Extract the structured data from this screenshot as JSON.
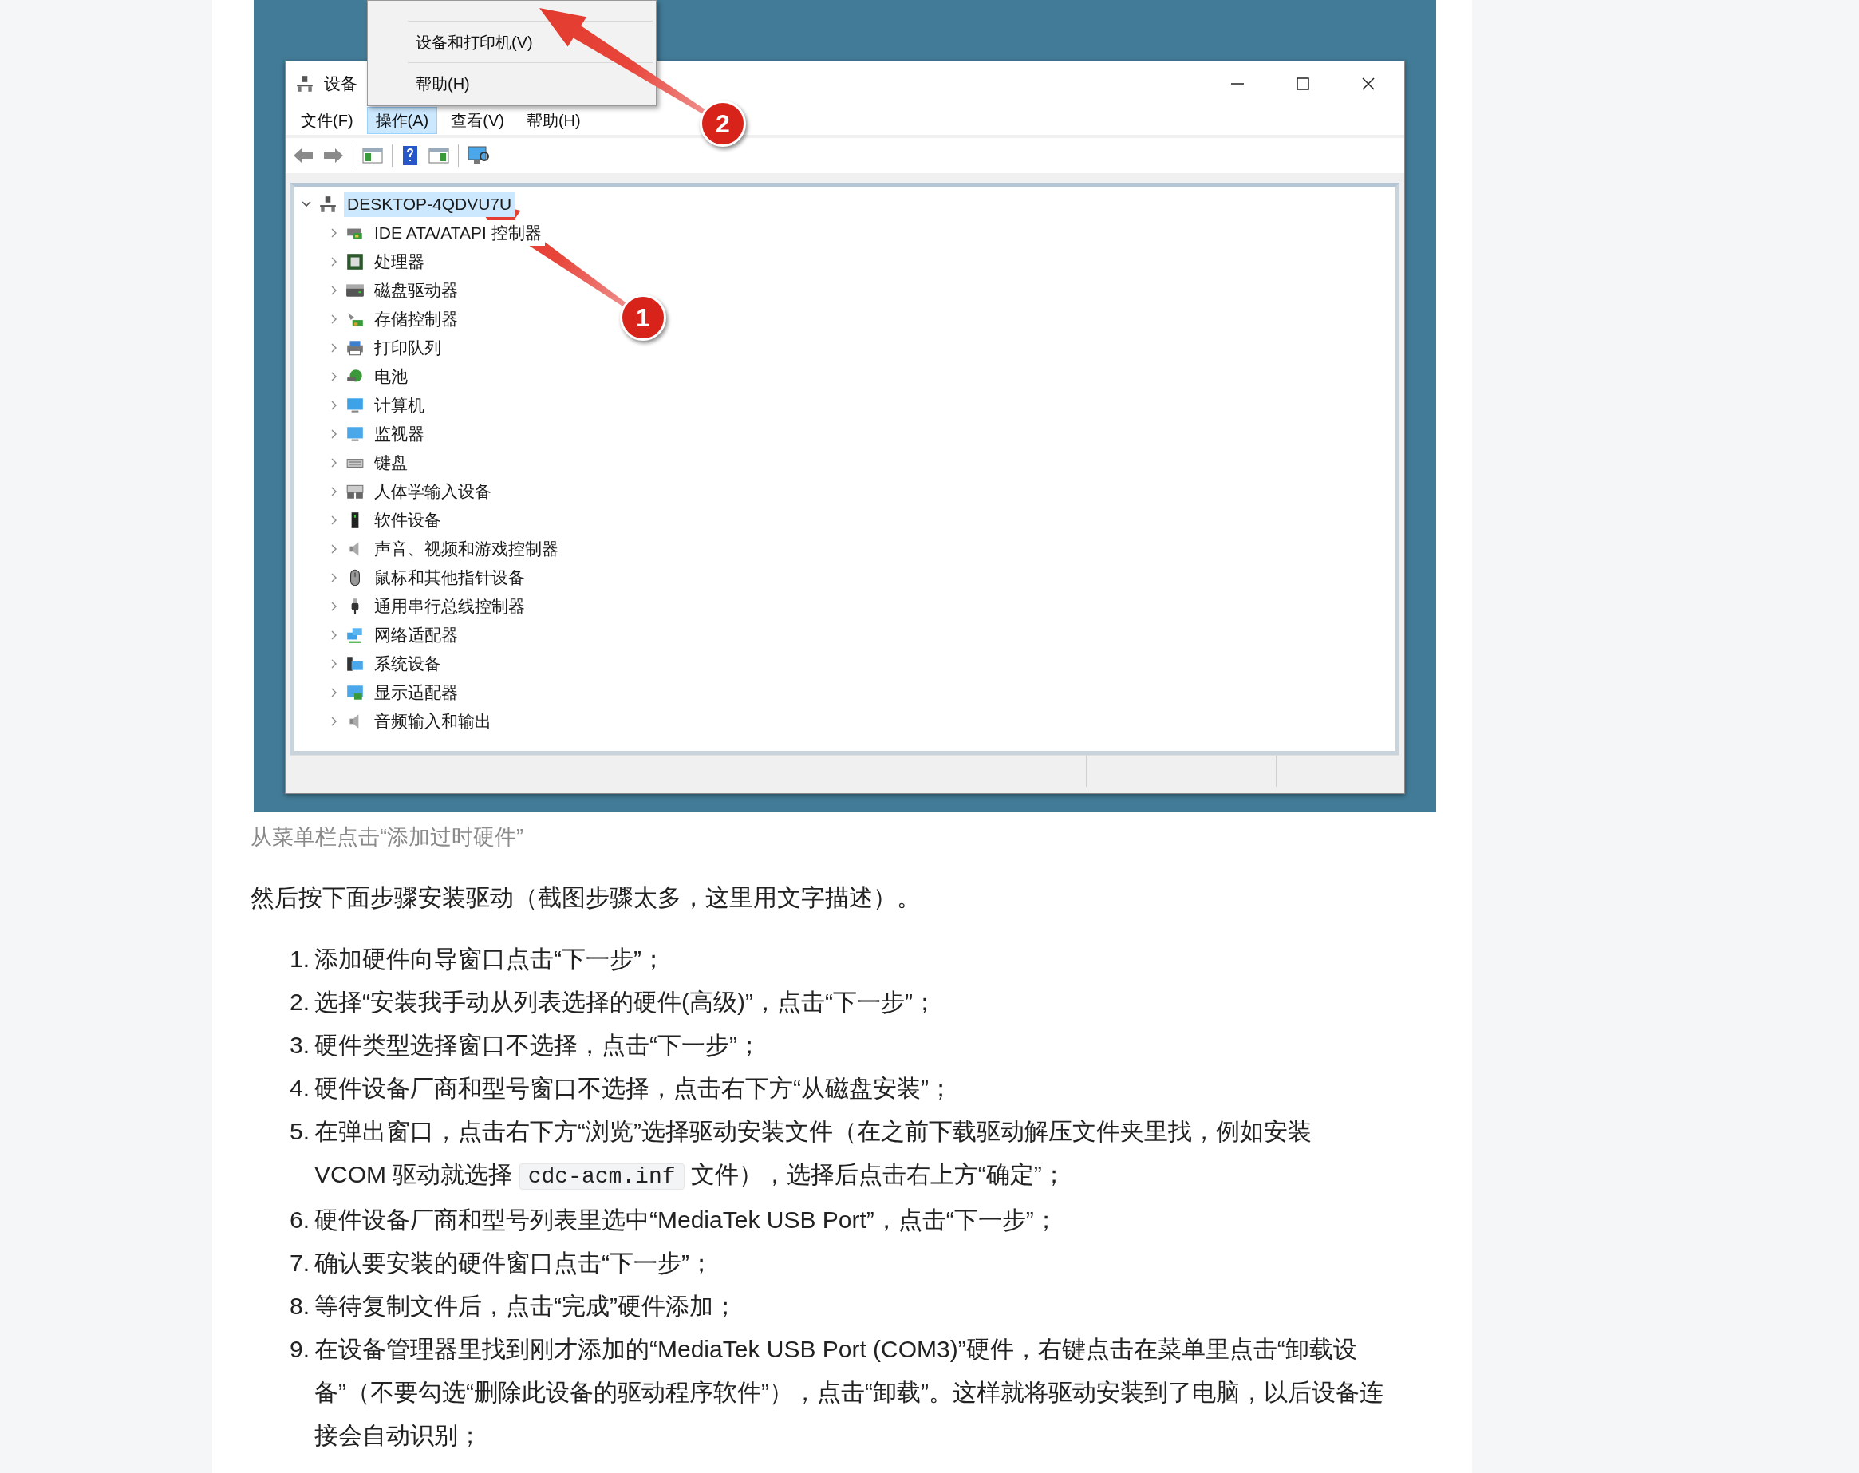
{
  "screenshot": {
    "window": {
      "title": "设备",
      "menu": [
        {
          "label": "文件(F)",
          "selected": false
        },
        {
          "label": "操作(A)",
          "selected": true
        },
        {
          "label": "查看(V)",
          "selected": false
        },
        {
          "label": "帮助(H)",
          "selected": false
        }
      ],
      "context_menu": [
        "设备和打印机(V)",
        "帮助(H)"
      ],
      "tree": {
        "label": "DESKTOP-4QDVU7U",
        "expanded": true,
        "selected": true,
        "children": [
          {
            "label": "IDE ATA/ATAPI 控制器",
            "expanded": false,
            "selected": false
          },
          {
            "label": "处理器",
            "expanded": false,
            "selected": false
          },
          {
            "label": "磁盘驱动器",
            "expanded": false,
            "selected": false
          },
          {
            "label": "存储控制器",
            "expanded": false,
            "selected": false
          },
          {
            "label": "打印队列",
            "expanded": false,
            "selected": false
          },
          {
            "label": "电池",
            "expanded": false,
            "selected": false
          },
          {
            "label": "计算机",
            "expanded": false,
            "selected": false
          },
          {
            "label": "监视器",
            "expanded": false,
            "selected": false
          },
          {
            "label": "键盘",
            "expanded": false,
            "selected": false
          },
          {
            "label": "人体学输入设备",
            "expanded": false,
            "selected": false
          },
          {
            "label": "软件设备",
            "expanded": false,
            "selected": false
          },
          {
            "label": "声音、视频和游戏控制器",
            "expanded": false,
            "selected": false
          },
          {
            "label": "鼠标和其他指针设备",
            "expanded": false,
            "selected": false
          },
          {
            "label": "通用串行总线控制器",
            "expanded": false,
            "selected": false
          },
          {
            "label": "网络适配器",
            "expanded": false,
            "selected": false
          },
          {
            "label": "系统设备",
            "expanded": false,
            "selected": false
          },
          {
            "label": "显示适配器",
            "expanded": false,
            "selected": false
          },
          {
            "label": "音频输入和输出",
            "expanded": false,
            "selected": false
          }
        ]
      }
    },
    "callouts": [
      {
        "number": "2"
      },
      {
        "number": "1"
      }
    ]
  },
  "caption": "从菜单栏点击“添加过时硬件”",
  "intro": "然后按下面步骤安装驱动（截图步骤太多，这里用文字描述）。",
  "steps": [
    {
      "number": "1.",
      "parts": [
        {
          "kind": "text",
          "text": "添加硬件向导窗口点击“下一步”；"
        }
      ]
    },
    {
      "number": "2.",
      "parts": [
        {
          "kind": "text",
          "text": "选择“安装我手动从列表选择的硬件(高级)”，点击“下一步”；"
        }
      ]
    },
    {
      "number": "3.",
      "parts": [
        {
          "kind": "text",
          "text": "硬件类型选择窗口不选择，点击“下一步”；"
        }
      ]
    },
    {
      "number": "4.",
      "parts": [
        {
          "kind": "text",
          "text": "硬件设备厂商和型号窗口不选择，点击右下方“从磁盘安装”；"
        }
      ]
    },
    {
      "number": "5.",
      "parts": [
        {
          "kind": "text",
          "text": "在弹出窗口，点击右下方“浏览”选择驱动安装文件（在之前下载驱动解压文件夹里找，例如安装 VCOM 驱动就选择 "
        },
        {
          "kind": "code",
          "text": "cdc-acm.inf"
        },
        {
          "kind": "text",
          "text": " 文件），选择后点击右上方“确定”；"
        }
      ]
    },
    {
      "number": "6.",
      "parts": [
        {
          "kind": "text",
          "text": "硬件设备厂商和型号列表里选中“MediaTek USB Port”，点击“下一步”；"
        }
      ]
    },
    {
      "number": "7.",
      "parts": [
        {
          "kind": "text",
          "text": "确认要安装的硬件窗口点击“下一步”；"
        }
      ]
    },
    {
      "number": "8.",
      "parts": [
        {
          "kind": "text",
          "text": "等待复制文件后，点击“完成”硬件添加；"
        }
      ]
    },
    {
      "number": "9.",
      "parts": [
        {
          "kind": "text",
          "text": "在设备管理器里找到刚才添加的“MediaTek USB Port (COM3)”硬件，右键点击在菜单里点击“卸载设备”（不要勾选“删除此设备的驱动程序软件”），点击“卸载”。这样就将驱动安装到了电脑，以后设备连接会自动识别；"
        }
      ]
    }
  ]
}
